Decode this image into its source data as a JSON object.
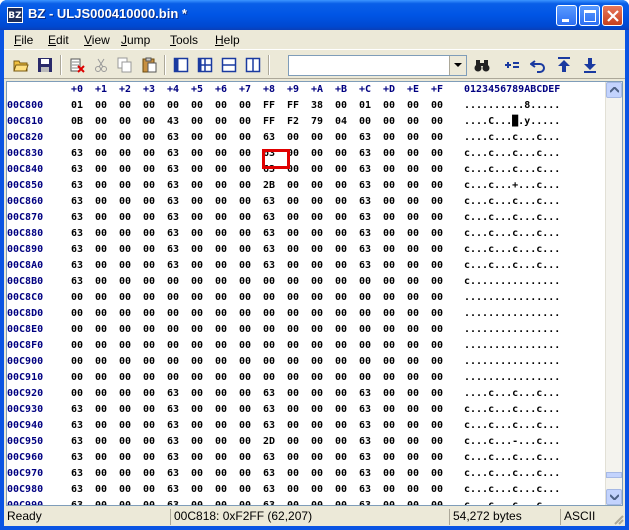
{
  "window": {
    "icon_text": "BZ",
    "title": "BZ - ULJS000410000.bin *"
  },
  "menu": [
    {
      "label": "File",
      "mnemonic": "F",
      "rest": "ile"
    },
    {
      "label": "Edit",
      "mnemonic": "E",
      "rest": "dit"
    },
    {
      "label": "View",
      "mnemonic": "V",
      "rest": "iew"
    },
    {
      "label": "Jump",
      "mnemonic": "J",
      "rest": "ump"
    },
    {
      "label": "Tools",
      "mnemonic": "T",
      "rest": "ools"
    },
    {
      "label": "Help",
      "mnemonic": "H",
      "rest": "elp"
    }
  ],
  "toolbar": {
    "icons": [
      "open-folder-icon",
      "save-disk-icon",
      "cut-delete-icon",
      "scissors-icon",
      "copy-icon",
      "paste-icon",
      "view-single-icon",
      "view-split-vertical-icon",
      "view-split-horizontal-icon",
      "view-split-columns-icon",
      "find-binoculars-icon",
      "compare-icon",
      "undo-icon",
      "jump-top-icon",
      "jump-end-icon"
    ],
    "combo_value": ""
  },
  "hex": {
    "column_header": [
      "+0",
      "+1",
      "+2",
      "+3",
      "+4",
      "+5",
      "+6",
      "+7",
      "+8",
      "+9",
      "+A",
      "+B",
      "+C",
      "+D",
      "+E",
      "+F"
    ],
    "ascii_header": "0123456789ABCDEF",
    "rows": [
      {
        "addr": "00C800",
        "bytes": [
          "01",
          "00",
          "00",
          "00",
          "00",
          "00",
          "00",
          "00",
          "FF",
          "FF",
          "38",
          "00",
          "01",
          "00",
          "00",
          "00"
        ],
        "ascii": "..........8....."
      },
      {
        "addr": "00C810",
        "bytes": [
          "0B",
          "00",
          "00",
          "00",
          "43",
          "00",
          "00",
          "00",
          "FF",
          "F2",
          "79",
          "04",
          "00",
          "00",
          "00",
          "00"
        ],
        "ascii": "....C...█.y....."
      },
      {
        "addr": "00C820",
        "bytes": [
          "00",
          "00",
          "00",
          "00",
          "63",
          "00",
          "00",
          "00",
          "63",
          "00",
          "00",
          "00",
          "63",
          "00",
          "00",
          "00"
        ],
        "ascii": "....c...c...c..."
      },
      {
        "addr": "00C830",
        "bytes": [
          "63",
          "00",
          "00",
          "00",
          "63",
          "00",
          "00",
          "00",
          "63",
          "00",
          "00",
          "00",
          "63",
          "00",
          "00",
          "00"
        ],
        "ascii": "c...c...c...c..."
      },
      {
        "addr": "00C840",
        "bytes": [
          "63",
          "00",
          "00",
          "00",
          "63",
          "00",
          "00",
          "00",
          "63",
          "00",
          "00",
          "00",
          "63",
          "00",
          "00",
          "00"
        ],
        "ascii": "c...c...c...c..."
      },
      {
        "addr": "00C850",
        "bytes": [
          "63",
          "00",
          "00",
          "00",
          "63",
          "00",
          "00",
          "00",
          "2B",
          "00",
          "00",
          "00",
          "63",
          "00",
          "00",
          "00"
        ],
        "ascii": "c...c...+...c..."
      },
      {
        "addr": "00C860",
        "bytes": [
          "63",
          "00",
          "00",
          "00",
          "63",
          "00",
          "00",
          "00",
          "63",
          "00",
          "00",
          "00",
          "63",
          "00",
          "00",
          "00"
        ],
        "ascii": "c...c...c...c..."
      },
      {
        "addr": "00C870",
        "bytes": [
          "63",
          "00",
          "00",
          "00",
          "63",
          "00",
          "00",
          "00",
          "63",
          "00",
          "00",
          "00",
          "63",
          "00",
          "00",
          "00"
        ],
        "ascii": "c...c...c...c..."
      },
      {
        "addr": "00C880",
        "bytes": [
          "63",
          "00",
          "00",
          "00",
          "63",
          "00",
          "00",
          "00",
          "63",
          "00",
          "00",
          "00",
          "63",
          "00",
          "00",
          "00"
        ],
        "ascii": "c...c...c...c..."
      },
      {
        "addr": "00C890",
        "bytes": [
          "63",
          "00",
          "00",
          "00",
          "63",
          "00",
          "00",
          "00",
          "63",
          "00",
          "00",
          "00",
          "63",
          "00",
          "00",
          "00"
        ],
        "ascii": "c...c...c...c..."
      },
      {
        "addr": "00C8A0",
        "bytes": [
          "63",
          "00",
          "00",
          "00",
          "63",
          "00",
          "00",
          "00",
          "63",
          "00",
          "00",
          "00",
          "63",
          "00",
          "00",
          "00"
        ],
        "ascii": "c...c...c...c..."
      },
      {
        "addr": "00C8B0",
        "bytes": [
          "63",
          "00",
          "00",
          "00",
          "00",
          "00",
          "00",
          "00",
          "00",
          "00",
          "00",
          "00",
          "00",
          "00",
          "00",
          "00"
        ],
        "ascii": "c..............."
      },
      {
        "addr": "00C8C0",
        "bytes": [
          "00",
          "00",
          "00",
          "00",
          "00",
          "00",
          "00",
          "00",
          "00",
          "00",
          "00",
          "00",
          "00",
          "00",
          "00",
          "00"
        ],
        "ascii": "................"
      },
      {
        "addr": "00C8D0",
        "bytes": [
          "00",
          "00",
          "00",
          "00",
          "00",
          "00",
          "00",
          "00",
          "00",
          "00",
          "00",
          "00",
          "00",
          "00",
          "00",
          "00"
        ],
        "ascii": "................"
      },
      {
        "addr": "00C8E0",
        "bytes": [
          "00",
          "00",
          "00",
          "00",
          "00",
          "00",
          "00",
          "00",
          "00",
          "00",
          "00",
          "00",
          "00",
          "00",
          "00",
          "00"
        ],
        "ascii": "................"
      },
      {
        "addr": "00C8F0",
        "bytes": [
          "00",
          "00",
          "00",
          "00",
          "00",
          "00",
          "00",
          "00",
          "00",
          "00",
          "00",
          "00",
          "00",
          "00",
          "00",
          "00"
        ],
        "ascii": "................"
      },
      {
        "addr": "00C900",
        "bytes": [
          "00",
          "00",
          "00",
          "00",
          "00",
          "00",
          "00",
          "00",
          "00",
          "00",
          "00",
          "00",
          "00",
          "00",
          "00",
          "00"
        ],
        "ascii": "................"
      },
      {
        "addr": "00C910",
        "bytes": [
          "00",
          "00",
          "00",
          "00",
          "00",
          "00",
          "00",
          "00",
          "00",
          "00",
          "00",
          "00",
          "00",
          "00",
          "00",
          "00"
        ],
        "ascii": "................"
      },
      {
        "addr": "00C920",
        "bytes": [
          "00",
          "00",
          "00",
          "00",
          "63",
          "00",
          "00",
          "00",
          "63",
          "00",
          "00",
          "00",
          "63",
          "00",
          "00",
          "00"
        ],
        "ascii": "....c...c...c..."
      },
      {
        "addr": "00C930",
        "bytes": [
          "63",
          "00",
          "00",
          "00",
          "63",
          "00",
          "00",
          "00",
          "63",
          "00",
          "00",
          "00",
          "63",
          "00",
          "00",
          "00"
        ],
        "ascii": "c...c...c...c..."
      },
      {
        "addr": "00C940",
        "bytes": [
          "63",
          "00",
          "00",
          "00",
          "63",
          "00",
          "00",
          "00",
          "63",
          "00",
          "00",
          "00",
          "63",
          "00",
          "00",
          "00"
        ],
        "ascii": "c...c...c...c..."
      },
      {
        "addr": "00C950",
        "bytes": [
          "63",
          "00",
          "00",
          "00",
          "63",
          "00",
          "00",
          "00",
          "2D",
          "00",
          "00",
          "00",
          "63",
          "00",
          "00",
          "00"
        ],
        "ascii": "c...c...-...c..."
      },
      {
        "addr": "00C960",
        "bytes": [
          "63",
          "00",
          "00",
          "00",
          "63",
          "00",
          "00",
          "00",
          "63",
          "00",
          "00",
          "00",
          "63",
          "00",
          "00",
          "00"
        ],
        "ascii": "c...c...c...c..."
      },
      {
        "addr": "00C970",
        "bytes": [
          "63",
          "00",
          "00",
          "00",
          "63",
          "00",
          "00",
          "00",
          "63",
          "00",
          "00",
          "00",
          "63",
          "00",
          "00",
          "00"
        ],
        "ascii": "c...c...c...c..."
      },
      {
        "addr": "00C980",
        "bytes": [
          "63",
          "00",
          "00",
          "00",
          "63",
          "00",
          "00",
          "00",
          "63",
          "00",
          "00",
          "00",
          "63",
          "00",
          "00",
          "00"
        ],
        "ascii": "c...c...c...c..."
      },
      {
        "addr": "00C990",
        "bytes": [
          "63",
          "00",
          "00",
          "00",
          "63",
          "00",
          "00",
          "00",
          "63",
          "00",
          "00",
          "00",
          "63",
          "00",
          "00",
          "00"
        ],
        "ascii": "c...c...c...c..."
      }
    ],
    "selected": {
      "row": 1,
      "col": 8
    },
    "highlight_color": "#e00000"
  },
  "status": {
    "ready": "Ready",
    "position": "00C818: 0xF2FF (62,207)",
    "size": "54,272 bytes",
    "encoding": "ASCII"
  }
}
